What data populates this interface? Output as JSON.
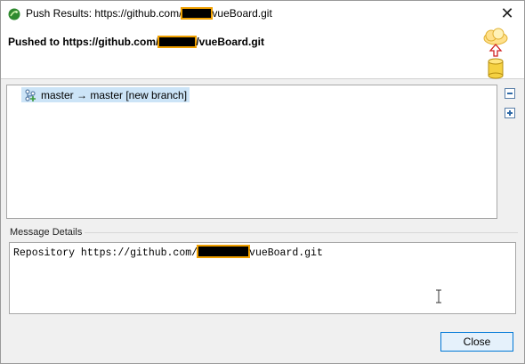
{
  "window": {
    "title_prefix": "Push Results: https://github.com/",
    "title_suffix": "vueBoard.git",
    "close_glyph": "✕"
  },
  "header": {
    "title_prefix": "Pushed to https://github.com/",
    "title_suffix": "/vueBoard.git",
    "icon": "push-cloud-database-icon"
  },
  "tree": {
    "items": [
      {
        "label": "master → master [new branch]",
        "icon": "branch-icon"
      }
    ],
    "collapse_icon": "collapse-all-icon",
    "expand_icon": "expand-all-icon"
  },
  "message_details": {
    "label": "Message Details",
    "text_prefix": "Repository https://github.com/",
    "text_suffix": "vueBoard.git"
  },
  "buttons": {
    "close_label": "Close"
  },
  "colors": {
    "selection": "#cce4f7",
    "accent": "#0078d7",
    "redaction_outline": "#f0a000"
  }
}
